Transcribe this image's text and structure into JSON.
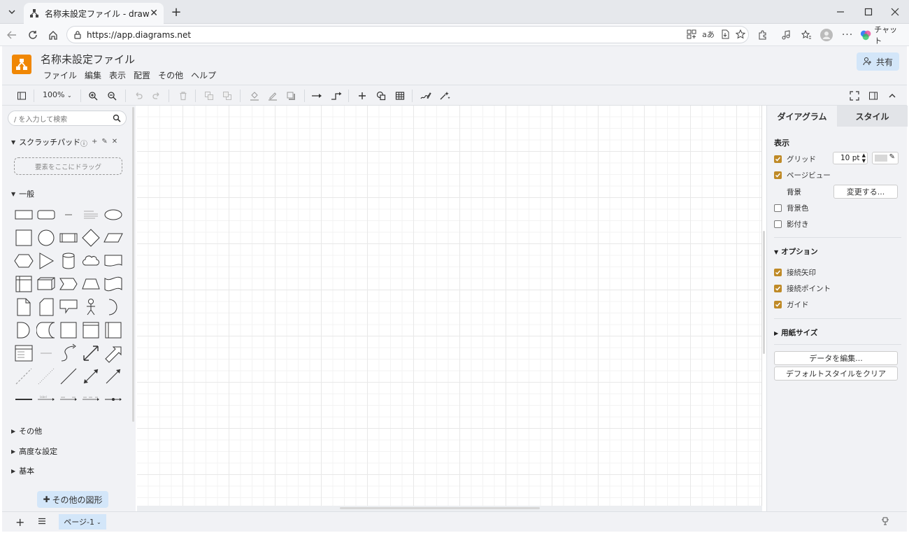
{
  "browser": {
    "tab_title": "名称未設定ファイル - draw.io",
    "url": "https://app.diagrams.net",
    "chat_label": "チャット"
  },
  "app": {
    "title": "名称未設定ファイル",
    "menu": [
      "ファイル",
      "編集",
      "表示",
      "配置",
      "その他",
      "ヘルプ"
    ],
    "share_label": "共有",
    "brand_color": "#f08705"
  },
  "toolbar": {
    "zoom": "100%"
  },
  "sidebar": {
    "search_placeholder": "/ を入力して検索",
    "scratchpad_title": "スクラッチパッド",
    "scratchpad_drop": "要素をここにドラッグ",
    "general_title": "一般",
    "sections": [
      "その他",
      "高度な設定",
      "基本"
    ],
    "more_shapes": "その他の図形"
  },
  "format_panel": {
    "tabs": [
      "ダイアグラム",
      "スタイル"
    ],
    "view_title": "表示",
    "grid_label": "グリッド",
    "grid_size": "10 pt",
    "page_view_label": "ページビュー",
    "background_label": "背景",
    "change_button": "変更する...",
    "background_color_label": "背景色",
    "shadow_label": "影付き",
    "options_title": "オプション",
    "connection_arrows_label": "接続矢印",
    "connection_points_label": "接続ポイント",
    "guides_label": "ガイド",
    "paper_size_title": "用紙サイズ",
    "edit_data_button": "データを編集...",
    "clear_style_button": "デフォルトスタイルをクリア",
    "checkbox_accent": "#bf8a27"
  },
  "footer": {
    "page_tab": "ページ-1"
  }
}
